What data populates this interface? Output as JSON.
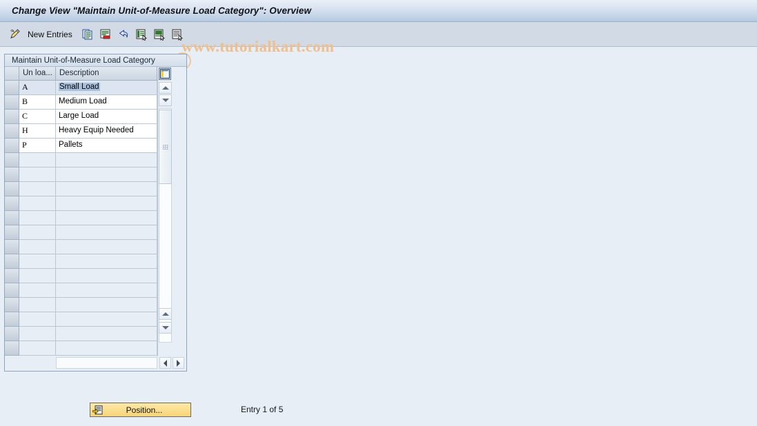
{
  "window": {
    "title": "Change View \"Maintain Unit-of-Measure Load Category\": Overview"
  },
  "toolbar": {
    "edit_icon": "pencil-edit-icon",
    "new_entries_label": "New Entries",
    "buttons": [
      {
        "name": "copy-icon",
        "title": "Copy As..."
      },
      {
        "name": "delete-icon",
        "title": "Delete"
      },
      {
        "name": "undo-icon",
        "title": "Undo Change"
      },
      {
        "name": "select-all-icon",
        "title": "Select All"
      },
      {
        "name": "select-block-icon",
        "title": "Select Block"
      },
      {
        "name": "deselect-all-icon",
        "title": "Deselect All"
      }
    ],
    "watermark": "www.tutorialkart.com",
    "watermark_color": "#efbf8f"
  },
  "table": {
    "caption": "Maintain Unit-of-Measure Load Category",
    "config_icon": "table-settings-icon",
    "columns": [
      "Un loa...",
      "Description"
    ],
    "rows": [
      {
        "code": "A",
        "description": "Small Load",
        "selected": true
      },
      {
        "code": "B",
        "description": "Medium Load",
        "selected": false
      },
      {
        "code": "C",
        "description": "Large Load",
        "selected": false
      },
      {
        "code": "H",
        "description": "Heavy Equip Needed",
        "selected": false
      },
      {
        "code": "P",
        "description": "Pallets",
        "selected": false
      }
    ],
    "empty_row_count": 14,
    "scroll": {
      "up_icon": "scroll-up-icon",
      "down_icon": "scroll-down-icon",
      "left_icon": "scroll-left-icon",
      "right_icon": "scroll-right-icon"
    }
  },
  "footer": {
    "position_button": "Position...",
    "position_icon": "position-jump-icon",
    "entry_status": "Entry 1 of 5"
  },
  "colors": {
    "title_bar": "#b9cbe2",
    "toolbar_bg": "#d2dbe5",
    "body_bg": "#e8eef5",
    "selection": "#a9c1dd",
    "button_yellow": "#f7d579"
  }
}
